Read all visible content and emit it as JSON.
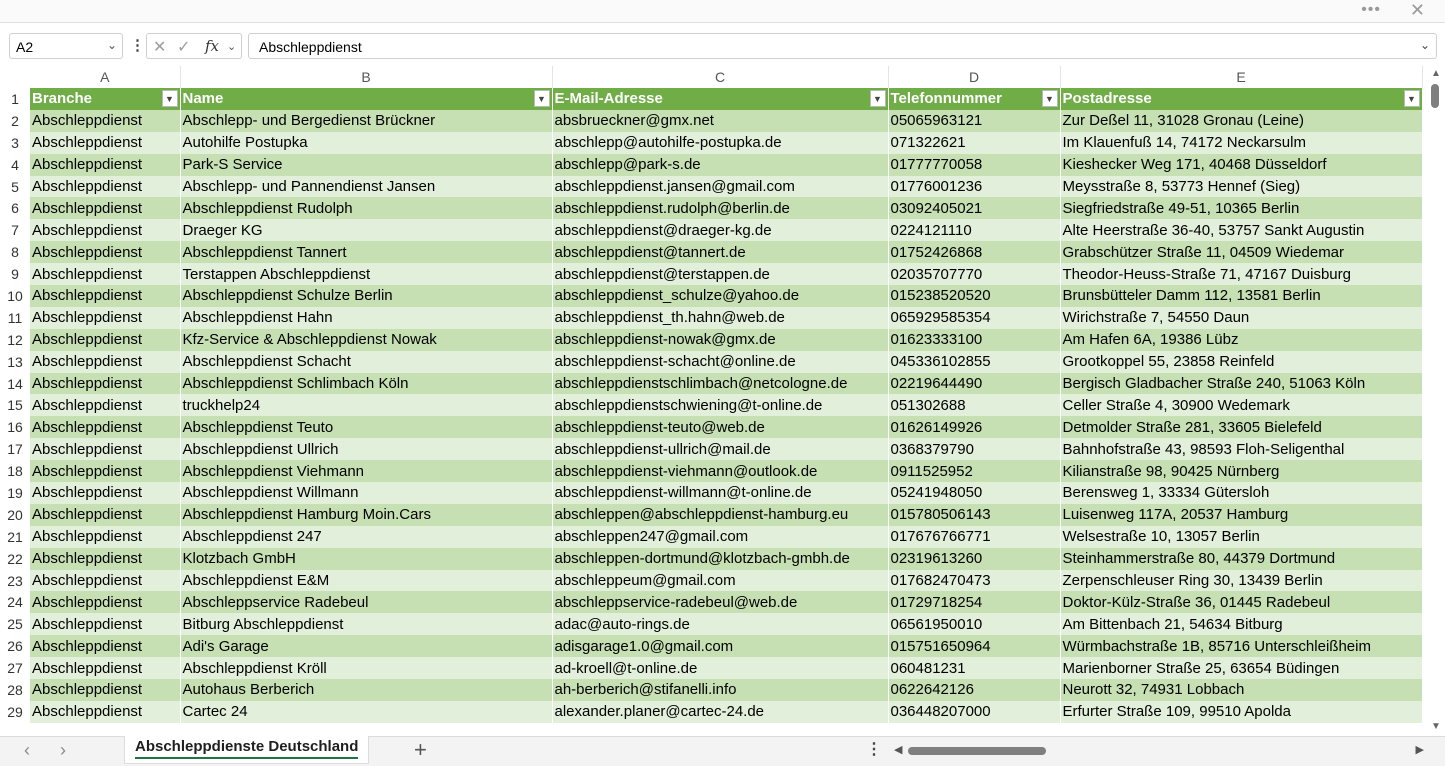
{
  "window": {
    "more_label": "•••",
    "close_label": "✕"
  },
  "formula_bar": {
    "name_box": "A2",
    "more_label": "⋮",
    "cancel_label": "✕",
    "enter_label": "✓",
    "fx_label": "fx",
    "value": "Abschleppdienst"
  },
  "columns": [
    "A",
    "B",
    "C",
    "D",
    "E"
  ],
  "headers": [
    "Branche",
    "Name",
    "E-Mail-Adresse",
    "Telefonnummer",
    "Postadresse"
  ],
  "rows": [
    {
      "n": "2",
      "c": [
        "Abschleppdienst",
        "Abschlepp- und Bergedienst Brückner",
        "absbrueckner@gmx.net",
        "05065963121",
        "Zur Deßel 11, 31028 Gronau (Leine)"
      ]
    },
    {
      "n": "3",
      "c": [
        "Abschleppdienst",
        "Autohilfe Postupka",
        "abschlepp@autohilfe-postupka.de",
        "071322621",
        "Im Klauenfuß 14, 74172 Neckarsulm"
      ]
    },
    {
      "n": "4",
      "c": [
        "Abschleppdienst",
        "Park-S Service",
        "abschlepp@park-s.de",
        "01777770058",
        "Kieshecker Weg 171, 40468 Düsseldorf"
      ]
    },
    {
      "n": "5",
      "c": [
        "Abschleppdienst",
        "Abschlepp- und Pannendienst Jansen",
        "abschleppdienst.jansen@gmail.com",
        "01776001236",
        "Meysstraße 8, 53773 Hennef (Sieg)"
      ]
    },
    {
      "n": "6",
      "c": [
        "Abschleppdienst",
        "Abschleppdienst Rudolph",
        "abschleppdienst.rudolph@berlin.de",
        "03092405021",
        "Siegfriedstraße 49-51, 10365 Berlin"
      ]
    },
    {
      "n": "7",
      "c": [
        "Abschleppdienst",
        "Draeger KG",
        "abschleppdienst@draeger-kg.de",
        "0224121110",
        "Alte Heerstraße 36-40, 53757 Sankt Augustin"
      ]
    },
    {
      "n": "8",
      "c": [
        "Abschleppdienst",
        "Abschleppdienst Tannert",
        "abschleppdienst@tannert.de",
        "01752426868",
        "Grabschützer Straße 11, 04509 Wiedemar"
      ]
    },
    {
      "n": "9",
      "c": [
        "Abschleppdienst",
        "Terstappen Abschleppdienst",
        "abschleppdienst@terstappen.de",
        "02035707770",
        "Theodor-Heuss-Straße 71, 47167 Duisburg"
      ]
    },
    {
      "n": "10",
      "c": [
        "Abschleppdienst",
        "Abschleppdienst Schulze Berlin",
        "abschleppdienst_schulze@yahoo.de",
        "015238520520",
        "Brunsbütteler Damm 112, 13581 Berlin"
      ]
    },
    {
      "n": "11",
      "c": [
        "Abschleppdienst",
        "Abschleppdienst Hahn",
        "abschleppdienst_th.hahn@web.de",
        "065929585354",
        "Wirichstraße 7, 54550 Daun"
      ]
    },
    {
      "n": "12",
      "c": [
        "Abschleppdienst",
        "Kfz-Service & Abschleppdienst Nowak",
        "abschleppdienst-nowak@gmx.de",
        "01623333100",
        "Am Hafen 6A, 19386 Lübz"
      ]
    },
    {
      "n": "13",
      "c": [
        "Abschleppdienst",
        "Abschleppdienst Schacht",
        "abschleppdienst-schacht@online.de",
        "045336102855",
        "Grootkoppel 55, 23858 Reinfeld"
      ]
    },
    {
      "n": "14",
      "c": [
        "Abschleppdienst",
        "Abschleppdienst Schlimbach Köln",
        "abschleppdienstschlimbach@netcologne.de",
        "02219644490",
        "Bergisch Gladbacher Straße 240, 51063 Köln"
      ]
    },
    {
      "n": "15",
      "c": [
        "Abschleppdienst",
        "truckhelp24",
        "abschleppdienstschwiening@t-online.de",
        "051302688",
        "Celler Straße 4, 30900 Wedemark"
      ]
    },
    {
      "n": "16",
      "c": [
        "Abschleppdienst",
        "Abschleppdienst Teuto",
        "abschleppdienst-teuto@web.de",
        "01626149926",
        "Detmolder Straße 281, 33605 Bielefeld"
      ]
    },
    {
      "n": "17",
      "c": [
        "Abschleppdienst",
        "Abschleppdienst Ullrich",
        "abschleppdienst-ullrich@mail.de",
        "0368379790",
        "Bahnhofstraße 43, 98593 Floh-Seligenthal"
      ]
    },
    {
      "n": "18",
      "c": [
        "Abschleppdienst",
        "Abschleppdienst Viehmann",
        "abschleppdienst-viehmann@outlook.de",
        "0911525952",
        "Kilianstraße 98, 90425 Nürnberg"
      ]
    },
    {
      "n": "19",
      "c": [
        "Abschleppdienst",
        "Abschleppdienst Willmann",
        "abschleppdienst-willmann@t-online.de",
        "05241948050",
        "Berensweg 1, 33334 Gütersloh"
      ]
    },
    {
      "n": "20",
      "c": [
        "Abschleppdienst",
        "Abschleppdienst Hamburg Moin.Cars",
        "abschleppen@abschleppdienst-hamburg.eu",
        "015780506143",
        "Luisenweg 117A, 20537 Hamburg"
      ]
    },
    {
      "n": "21",
      "c": [
        "Abschleppdienst",
        "Abschleppdienst 247",
        "abschleppen247@gmail.com",
        "017676766771",
        "Welsestraße 10, 13057 Berlin"
      ]
    },
    {
      "n": "22",
      "c": [
        "Abschleppdienst",
        "Klotzbach GmbH",
        "abschleppen-dortmund@klotzbach-gmbh.de",
        "02319613260",
        "Steinhammerstraße 80, 44379 Dortmund"
      ]
    },
    {
      "n": "23",
      "c": [
        "Abschleppdienst",
        "Abschleppdienst E&M",
        "abschleppeum@gmail.com",
        "017682470473",
        "Zerpenschleuser Ring 30, 13439 Berlin"
      ]
    },
    {
      "n": "24",
      "c": [
        "Abschleppdienst",
        "Abschleppservice Radebeul",
        "abschleppservice-radebeul@web.de",
        "01729718254",
        "Doktor-Külz-Straße 36, 01445 Radebeul"
      ]
    },
    {
      "n": "25",
      "c": [
        "Abschleppdienst",
        "Bitburg Abschleppdienst",
        "adac@auto-rings.de",
        "06561950010",
        "Am Bittenbach 21, 54634 Bitburg"
      ]
    },
    {
      "n": "26",
      "c": [
        "Abschleppdienst",
        "Adi's Garage",
        "adisgarage1.0@gmail.com",
        "015751650964",
        "Würmbachstraße 1B, 85716 Unterschleißheim"
      ]
    },
    {
      "n": "27",
      "c": [
        "Abschleppdienst",
        "Abschleppdienst Kröll",
        "ad-kroell@t-online.de",
        "060481231",
        "Marienborner Straße 25, 63654 Büdingen"
      ]
    },
    {
      "n": "28",
      "c": [
        "Abschleppdienst",
        "Autohaus Berberich",
        "ah-berberich@stifanelli.info",
        "0622642126",
        "Neurott 32, 74931 Lobbach"
      ]
    },
    {
      "n": "29",
      "c": [
        "Abschleppdienst",
        "Cartec 24",
        "alexander.planer@cartec-24.de",
        "036448207000",
        "Erfurter Straße 109, 99510 Apolda"
      ]
    }
  ],
  "sheet_tabs": {
    "active": "Abschleppdienste Deutschland",
    "add_label": "+",
    "prev_label": "‹",
    "next_label": "›",
    "more_label": "⋮"
  },
  "colors": {
    "header_green": "#70ad47",
    "band_dark": "#c6e0b4",
    "band_light": "#e2efda",
    "tab_underline": "#217346"
  }
}
